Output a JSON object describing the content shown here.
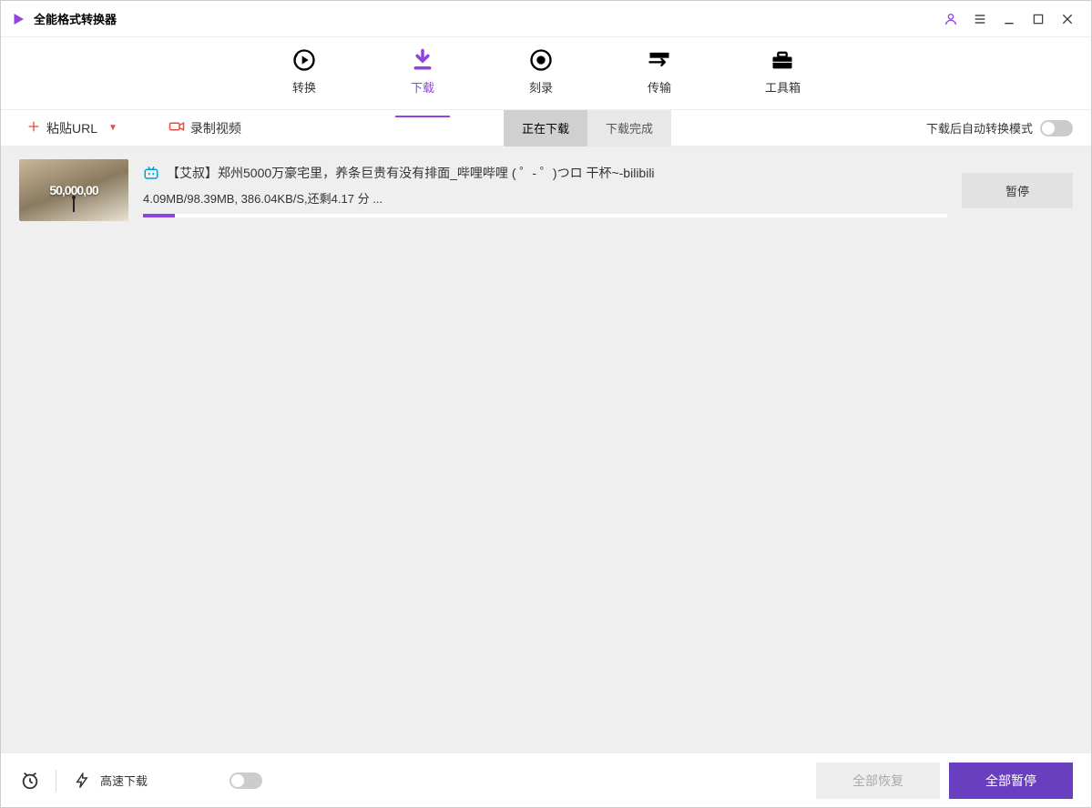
{
  "colors": {
    "accent": "#8e44dd",
    "danger": "#e74c3c",
    "primary_btn": "#6a3fbf"
  },
  "titlebar": {
    "app_name": "全能格式转换器"
  },
  "nav": {
    "tabs": [
      {
        "label": "转换",
        "icon": "convert-icon"
      },
      {
        "label": "下载",
        "icon": "download-icon",
        "active": true
      },
      {
        "label": "刻录",
        "icon": "burn-icon"
      },
      {
        "label": "传输",
        "icon": "transfer-icon"
      },
      {
        "label": "工具箱",
        "icon": "toolbox-icon"
      }
    ]
  },
  "toolbar": {
    "paste_url": "粘贴URL",
    "record_video": "录制视频",
    "seg_downloading": "正在下载",
    "seg_completed": "下载完成",
    "auto_convert_label": "下载后自动转换模式"
  },
  "list": {
    "items": [
      {
        "thumb_overlay": "50,000,00",
        "title": "【艾叔】郑州5000万豪宅里，养条巨贵有没有排面_哔哩哔哩 ( ゜- ゜)つロ  干杯~-bilibili",
        "status_line": "4.09MB/98.39MB, 386.04KB/S,还剩4.17 分 ...",
        "progress_percent": 4,
        "action_label": "暂停"
      }
    ]
  },
  "bottombar": {
    "highspeed_label": "高速下载",
    "resume_all": "全部恢复",
    "pause_all": "全部暂停"
  }
}
